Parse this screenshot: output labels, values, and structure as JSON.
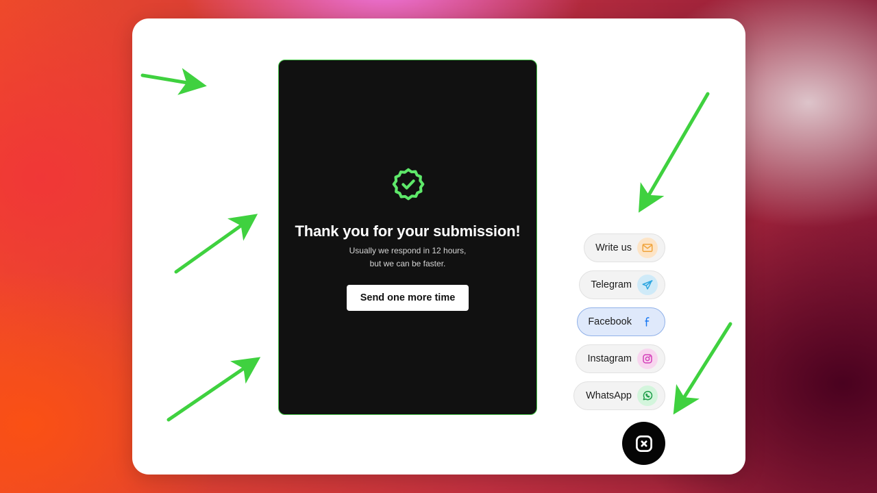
{
  "confirmation": {
    "title": "Thank you for your submission!",
    "subtitle_line1": "Usually we respond in 12 hours,",
    "subtitle_line2": "but we can be faster.",
    "button_label": "Send one more time",
    "icon": "verified-badge-check-icon"
  },
  "contacts": [
    {
      "label": "Write us",
      "icon": "mail-icon",
      "color": "#f0a43c"
    },
    {
      "label": "Telegram",
      "icon": "telegram-icon",
      "color": "#2ea6e0"
    },
    {
      "label": "Facebook",
      "icon": "facebook-icon",
      "color": "#1877f2"
    },
    {
      "label": "Instagram",
      "icon": "instagram-icon",
      "color": "#d23fb8"
    },
    {
      "label": "WhatsApp",
      "icon": "whatsapp-icon",
      "color": "#25c05a"
    }
  ],
  "close_button": {
    "icon": "close-icon"
  },
  "colors": {
    "accent_green": "#49c94b",
    "panel_background": "#111111",
    "badge_green": "#5ee86a"
  }
}
